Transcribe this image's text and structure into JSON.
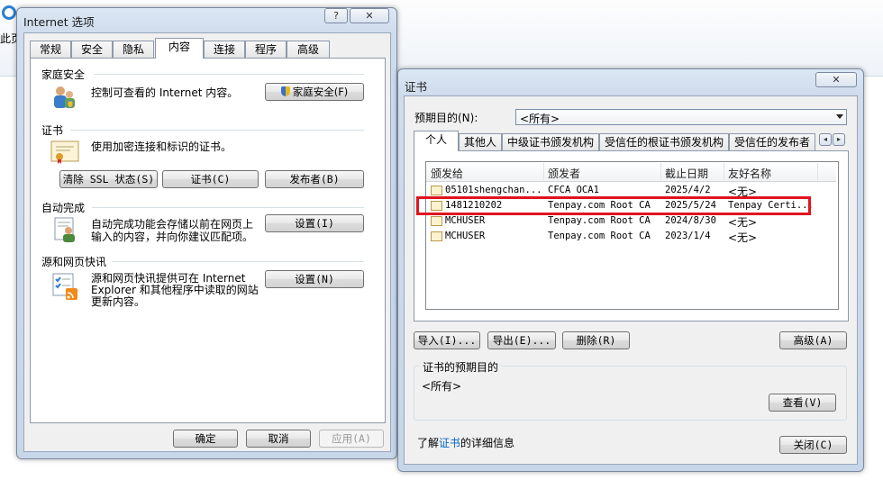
{
  "background": {
    "partial_text": "此页"
  },
  "inet": {
    "title": "Internet 选项",
    "help": "?",
    "close": "✕",
    "tabs": [
      "常规",
      "安全",
      "隐私",
      "内容",
      "连接",
      "程序",
      "高级"
    ],
    "family": {
      "title": "家庭安全",
      "desc": "控制可查看的 Internet 内容。",
      "button": "家庭安全(F)"
    },
    "certs": {
      "title": "证书",
      "desc": "使用加密连接和标识的证书。",
      "clear_ssl": "清除 SSL 状态(S)",
      "certs_btn": "证书(C)",
      "publishers": "发布者(B)"
    },
    "autocomplete": {
      "title": "自动完成",
      "desc1": "自动完成功能会存储以前在网页上",
      "desc2": "输入的内容，并向你建议匹配项。",
      "button": "设置(I)"
    },
    "feeds": {
      "title": "源和网页快讯",
      "desc1": "源和网页快讯提供可在 Internet",
      "desc2": "Explorer 和其他程序中读取的网站",
      "desc3": "更新内容。",
      "button": "设置(N)"
    },
    "ok": "确定",
    "cancel": "取消",
    "apply": "应用(A)"
  },
  "certwin": {
    "title": "证书",
    "close": "✕",
    "purpose_label": "预期目的(N):",
    "purpose_value": "<所有>",
    "tabs": [
      "个人",
      "其他人",
      "中级证书颁发机构",
      "受信任的根证书颁发机构",
      "受信任的发布者"
    ],
    "columns": [
      "颁发给",
      "颁发者",
      "截止日期",
      "友好名称"
    ],
    "rows": [
      {
        "to": "05101shengchan...",
        "by": "CFCA OCA1",
        "exp": "2025/4/2",
        "name": "<无>"
      },
      {
        "to": "1481210202",
        "by": "Tenpay.com Root CA",
        "exp": "2025/5/24",
        "name": "Tenpay Certi..."
      },
      {
        "to": "MCHUSER",
        "by": "Tenpay.com Root CA",
        "exp": "2024/8/30",
        "name": "<无>"
      },
      {
        "to": "MCHUSER",
        "by": "Tenpay.com Root CA",
        "exp": "2023/1/4",
        "name": "<无>"
      }
    ],
    "import": "导入(I)...",
    "export": "导出(E)...",
    "remove": "删除(R)",
    "advanced": "高级(A)",
    "purposes_group": "证书的预期目的",
    "purposes_value": "<所有>",
    "view": "查看(V)",
    "learn_pre": "了解",
    "learn_link": "证书",
    "learn_post": "的详细信息",
    "close_btn": "关闭(C)"
  },
  "colors": {
    "highlight": "#e0141e",
    "link": "#0066cc"
  }
}
